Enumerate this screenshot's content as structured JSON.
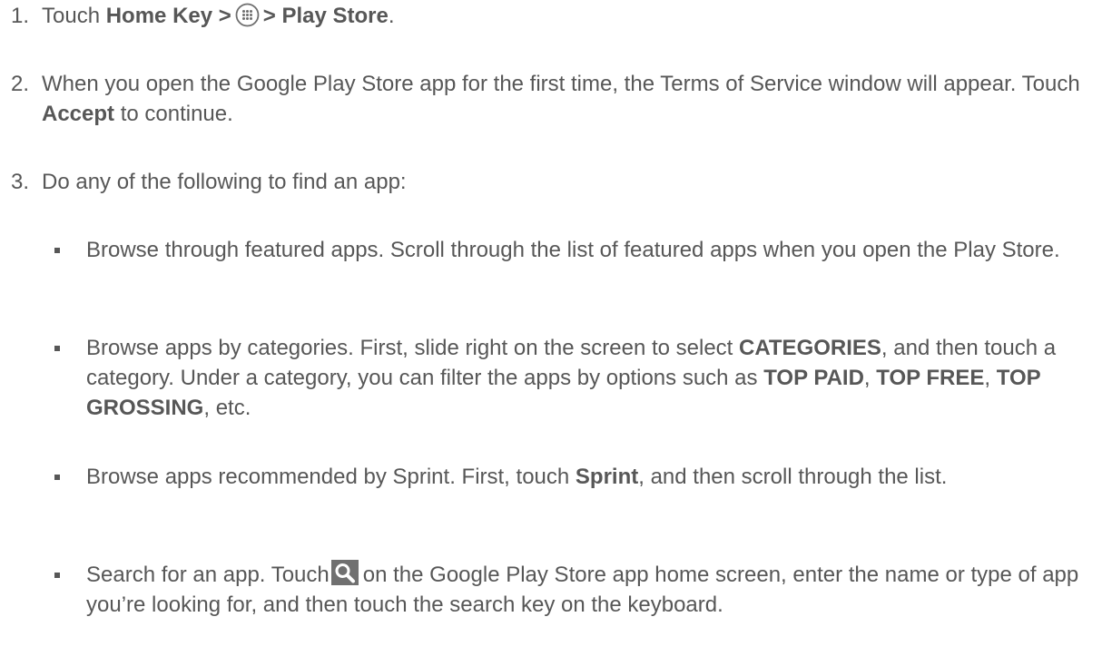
{
  "steps": [
    {
      "number": "1.",
      "pre": "Touch ",
      "bold1": "Home Key >",
      "bold2": "> Play Store",
      "post": "."
    },
    {
      "number": "2.",
      "pre": "When you open the Google Play Store app for the first time, the Terms of Service window will appear. Touch ",
      "bold": "Accept",
      "post": " to continue."
    },
    {
      "number": "3.",
      "text": "Do any of the following to find an app:"
    }
  ],
  "bullets": [
    {
      "text": "Browse through featured apps. Scroll through the list of featured apps when you open the Play Store."
    },
    {
      "pre": "Browse apps by categories. First, slide right on the screen to select ",
      "b1": "CATEGORIES",
      "mid1": ", and then touch a category. Under a category, you can filter the apps by options such as ",
      "b2": "TOP PAID",
      "sep1": ", ",
      "b3": "TOP FREE",
      "sep2": ", ",
      "b4": "TOP GROSSING",
      "post": ", etc."
    },
    {
      "pre": "Browse apps recommended by Sprint. First, touch ",
      "bold": "Sprint",
      "post": ", and then scroll through the list."
    },
    {
      "pre": "Search for an app. Touch",
      "post": "on the Google Play Store app home screen, enter the name or type of app you’re looking for, and then touch the search key on the keyboard."
    }
  ],
  "icons": {
    "apps": "apps-grid-icon",
    "search": "search-icon"
  }
}
